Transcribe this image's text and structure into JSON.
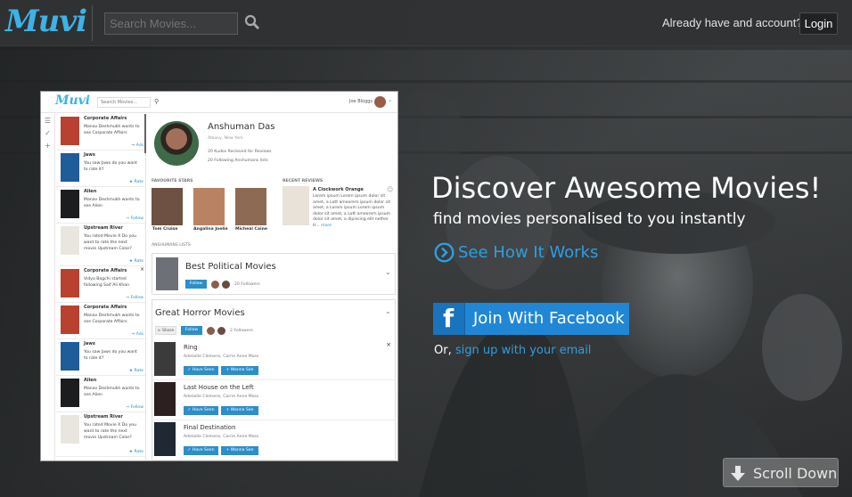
{
  "header": {
    "logo": "Muvi",
    "search_placeholder": "Search Movies...",
    "account_prompt": "Already have and account?",
    "login_label": "Login"
  },
  "preview": {
    "logo": "Muvi",
    "search_placeholder": "Search Movies...",
    "user_name": "Joe Bloggs",
    "feed": [
      {
        "title": "Corporate Affairs",
        "desc": "Manav Deshmukh wants to see Corporate Affairs",
        "action": "Ask",
        "poster_color": "#b8412f"
      },
      {
        "title": "Jaws",
        "desc": "You saw Jaws do you want to rate it?",
        "action": "Rate",
        "poster_color": "#1e5c9a"
      },
      {
        "title": "Alien",
        "desc": "Manav Deshmukh wants to see Alien",
        "action": "Follow",
        "poster_color": "#1b1d1f"
      },
      {
        "title": "Upstream River",
        "desc": "You rated Movie X Do you want to rate the next movie Upstream Color?",
        "action": "Rate",
        "poster_color": "#e9e6df"
      },
      {
        "title": "Corporate Affairs",
        "desc": "Vidya Bagchi started following Saif Ali Khan",
        "action": "Follow",
        "poster_color": "#b8412f"
      },
      {
        "title": "Corporate Affairs",
        "desc": "Manav Deshmukh wants to see Corporate Affairs",
        "action": "Ask",
        "poster_color": "#b8412f"
      },
      {
        "title": "Jaws",
        "desc": "You saw Jaws do you want to rate it?",
        "action": "Rate",
        "poster_color": "#1e5c9a"
      },
      {
        "title": "Alien",
        "desc": "Manav Deshmukh wants to see Alien",
        "action": "Follow",
        "poster_color": "#1b1d1f"
      },
      {
        "title": "Upstream River",
        "desc": "You rated Movie X Do you want to rate the next movie Upstream Color?",
        "action": "Rate",
        "poster_color": "#e9e6df"
      }
    ],
    "profile": {
      "name": "Anshuman Das",
      "location": "Albany, New York",
      "stat_reviews": "20 Kudos Recieved for Reviews",
      "stat_following": "20 Following Anshumans lists"
    },
    "favourite_stars_label": "FAVOURITE STARS",
    "stars": [
      {
        "name": "Tom Cruise",
        "color": "#6e5142"
      },
      {
        "name": "Angalina Joelie",
        "color": "#b98363"
      },
      {
        "name": "Micheal Caine",
        "color": "#8d6a54"
      }
    ],
    "recent_reviews_label": "RECENT REVIEWS",
    "review": {
      "title": "A Clockwork Orange",
      "body": "Lorem ipsum Lorem ipsum dolor sit amet, a Lott ameorem ipsum dolor sit amet, a Lorem ipsum Lorem ipsum dolor sit amet, a Lott ameorem ipsum dolor sit amet, a dipiscing elit nether tr...",
      "more": "more"
    },
    "lists_label": "ANSHUMANS LISTS",
    "list_one": {
      "title": "Best Political Movies",
      "follow_label": "Follow",
      "followers": "20 Followers"
    },
    "list_two": {
      "title": "Great Horror Movies",
      "share_label": "Share",
      "follow_label": "Follow",
      "followers": "2 Followers",
      "movies": [
        {
          "title": "Ring",
          "cast": "Adelaide Clemens, Carrie Anne Moss",
          "seen_label": "Have Seen",
          "wanna_label": "Wanna See",
          "poster_color": "#3b3b3b"
        },
        {
          "title": "Last House on the Left",
          "cast": "Adelaide Clemens, Carrie Anne Moss",
          "seen_label": "Have Seen",
          "wanna_label": "Wanna See",
          "poster_color": "#2c2020"
        },
        {
          "title": "Final Destination",
          "cast": "Adelaide Clemens, Carrie Anne Moss",
          "seen_label": "Have Seen",
          "wanna_label": "Wanna See",
          "poster_color": "#202833"
        }
      ]
    }
  },
  "hero": {
    "headline": "Discover Awesome Movies!",
    "subhead": "find movies personalised to you instantly",
    "see_how": "See How It Works",
    "facebook_label": "Join With Facebook",
    "or_text": "Or,",
    "signup_link": "sign up with your email",
    "scroll_down": "Scroll Down"
  },
  "colors": {
    "brand": "#3db2e6",
    "link": "#2d9fe2",
    "facebook": "#2087d7",
    "topbar": "#303233"
  }
}
